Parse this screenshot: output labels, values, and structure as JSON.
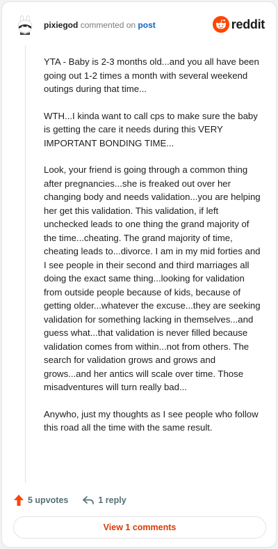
{
  "header": {
    "username": "pixiegod",
    "action": "commented on",
    "link": "post",
    "brand": "reddit",
    "brand_color": "#ff4500"
  },
  "comment": {
    "paragraphs": [
      "YTA - Baby is 2-3 months old...and you all have been going out 1-2 times a month with several weekend outings during that time...",
      "WTH...I kinda want to call cps to make sure the baby is getting the care it needs during this VERY IMPORTANT BONDING TIME...",
      "Look, your friend is going through a common thing after pregnancies...she is freaked out over her changing body and needs validation...you are helping her get this validation. This validation, if left unchecked leads to one thing the grand majority of the time...cheating. The grand majority of time, cheating leads to...divorce. I am in my mid forties and I see people in their second and third marriages all doing the exact same thing...looking for validation from outside people because of kids, because of getting older...whatever the excuse...they are seeking validation for something lacking in themselves...and guess what...that validation is never filled because validation comes from within...not from others. The search for validation grows and grows and grows...and her antics will scale over time. Those misadventures will turn really bad...",
      "Anywho, just my thoughts as I see people who follow this road all the time with the same result."
    ]
  },
  "actions": {
    "upvotes": "5 upvotes",
    "reply": "1 reply"
  },
  "footer": {
    "view_comments": "View 1 comments"
  },
  "colors": {
    "accent": "#d93a00",
    "upvote": "#ff4500",
    "link": "#0a66c2"
  }
}
